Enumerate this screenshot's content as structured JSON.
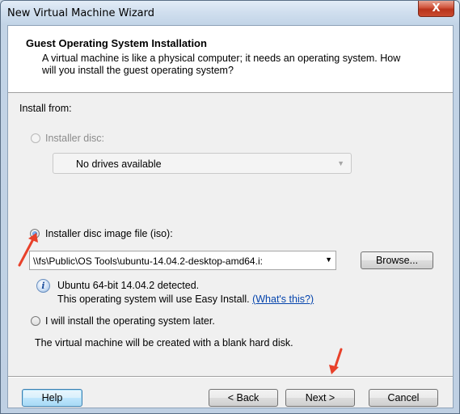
{
  "window": {
    "title": "New Virtual Machine Wizard",
    "close_glyph": "X"
  },
  "header": {
    "title": "Guest Operating System Installation",
    "description": "A virtual machine is like a physical computer; it needs an operating system. How will you install the guest operating system?"
  },
  "install_from_label": "Install from:",
  "options": {
    "installer_disc": {
      "label": "Installer disc:",
      "enabled": false,
      "selected": false,
      "combo_value": "No drives available"
    },
    "iso": {
      "label": "Installer disc image file (iso):",
      "enabled": true,
      "selected": true,
      "path": "\\\\fs\\Public\\OS Tools\\ubuntu-14.04.2-desktop-amd64.i:",
      "browse_label": "Browse..."
    },
    "later": {
      "label": "I will install the operating system later.",
      "enabled": true,
      "selected": false,
      "description": "The virtual machine will be created with a blank hard disk."
    }
  },
  "detection": {
    "line1": "Ubuntu 64-bit 14.04.2 detected.",
    "line2_prefix": "This operating system will use Easy Install.",
    "whats_this": "(What's this?)"
  },
  "footer": {
    "help": "Help",
    "back": "< Back",
    "next": "Next >",
    "cancel": "Cancel"
  },
  "colors": {
    "annotation_arrow": "#e8412a",
    "link": "#0645ad",
    "selected_radio": "#1a5fb4"
  },
  "icons": [
    "info-icon",
    "close-icon",
    "chevron-down-icon",
    "arrow-annotation"
  ]
}
